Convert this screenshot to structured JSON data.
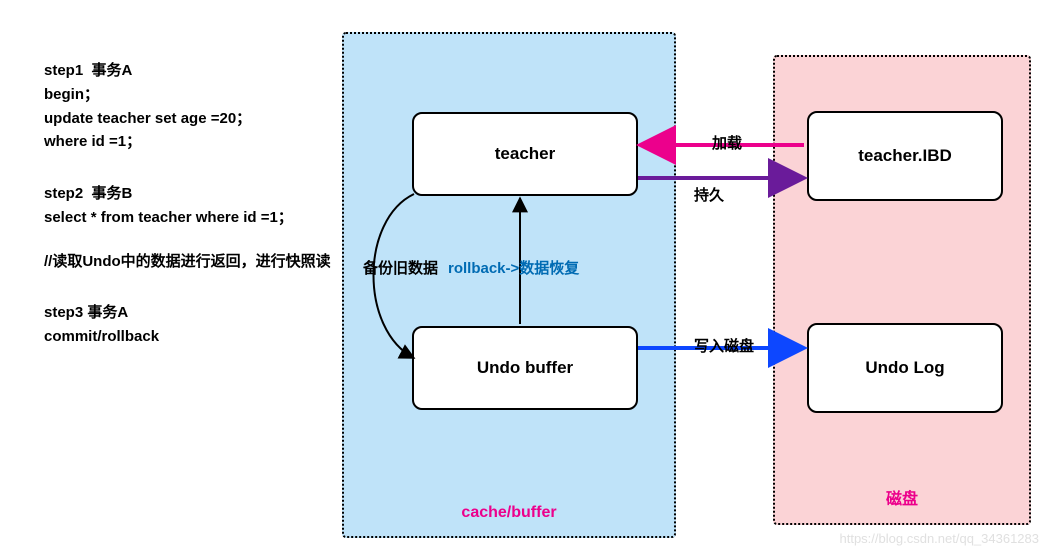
{
  "steps": {
    "s1_title": "step1  事务A",
    "s1_l1": "begin；",
    "s1_l2": "update teacher set age =20；",
    "s1_l3": "where id =1；",
    "s2_title": "step2  事务B",
    "s2_l1": "select * from teacher where id =1；",
    "s2_l2": "//读取Undo中的数据进行返回，进行快照读",
    "s3_title": "step3 事务A",
    "s3_l1": "commit/rollback"
  },
  "regions": {
    "cache_label": "cache/buffer",
    "disk_label": "磁盘"
  },
  "nodes": {
    "teacher": "teacher",
    "undo_buffer": "Undo buffer",
    "teacher_ibd": "teacher.IBD",
    "undo_log": "Undo Log"
  },
  "edges": {
    "load": "加载",
    "persist": "持久",
    "backup": "备份旧数据",
    "rollback": "rollback->数据恢复",
    "write_disk": "写入磁盘"
  },
  "watermark": "https://blog.csdn.net/qq_34361283",
  "colors": {
    "magenta": "#ec008c",
    "purple": "#6a1b9a",
    "blue": "#0d47ff",
    "link_blue": "#006bb3"
  }
}
